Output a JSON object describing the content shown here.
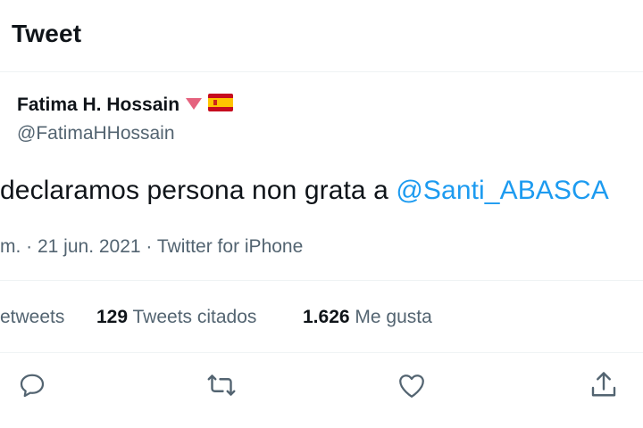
{
  "header": {
    "title": "Tweet"
  },
  "author": {
    "name": "Fatima H. Hossain",
    "handle": "@FatimaHHossain",
    "badges": [
      "red-triangle-emoji",
      "spain-flag-emoji"
    ]
  },
  "tweet": {
    "text_before": "declaramos persona non grata a ",
    "mention": "@Santi_ABASCA",
    "meta": "m. · 21 jun. 2021 · Twitter for iPhone"
  },
  "stats": {
    "retweets_label": "etweets",
    "quotes_count": "129",
    "quotes_label": "Tweets citados",
    "likes_count": "1.626",
    "likes_label": "Me gusta"
  },
  "colors": {
    "accent": "#1d9bf0",
    "text": "#0f1419",
    "secondary": "#536471",
    "divider": "#eff3f4"
  },
  "actions": [
    "reply-icon",
    "retweet-icon",
    "like-icon",
    "share-icon"
  ]
}
